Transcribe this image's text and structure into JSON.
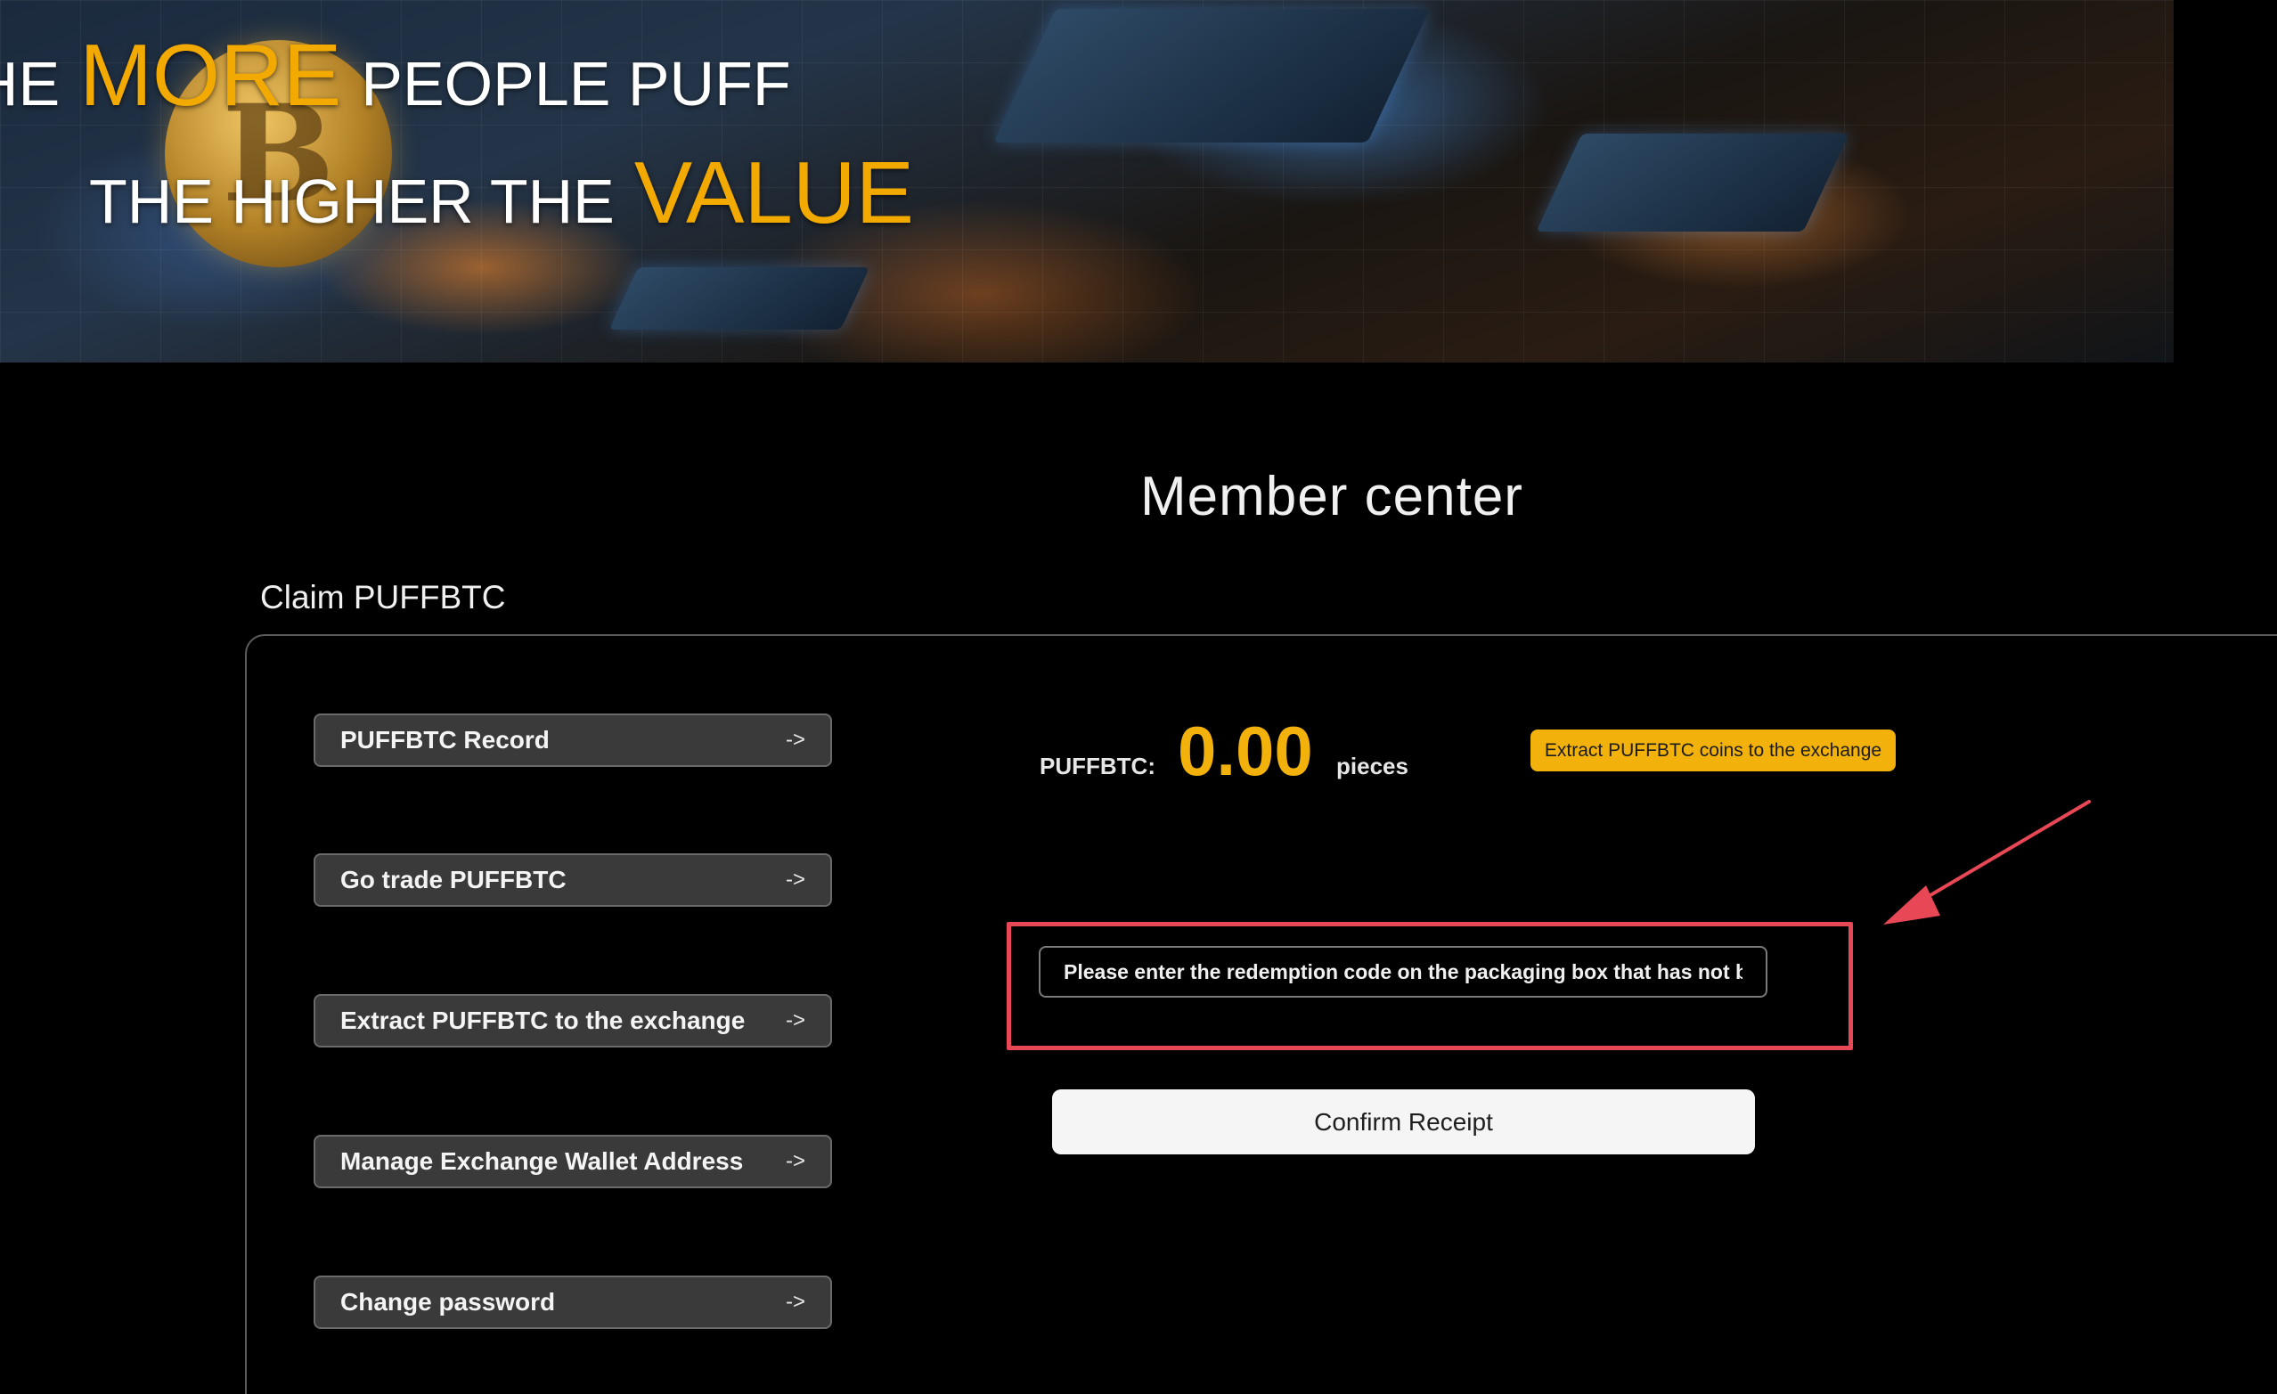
{
  "banner": {
    "line1_prefix": "HE",
    "line1_accent": "MORE",
    "line1_suffix": "PEOPLE PUFF",
    "line2_prefix": "THE HIGHER THE",
    "line2_accent": "VALUE",
    "coin_symbol": "B",
    "accent_color": "#f2a900"
  },
  "page": {
    "title": "Member center",
    "section_heading": "Claim PUFFBTC"
  },
  "menu": {
    "items": [
      {
        "label": "PUFFBTC Record",
        "arrow": "->"
      },
      {
        "label": "Go trade PUFFBTC",
        "arrow": "->"
      },
      {
        "label": "Extract PUFFBTC to the exchange",
        "arrow": "->"
      },
      {
        "label": "Manage Exchange Wallet Address",
        "arrow": "->"
      },
      {
        "label": "Change password",
        "arrow": "->"
      }
    ]
  },
  "balance": {
    "label": "PUFFBTC:",
    "value": "0.00",
    "unit": "pieces",
    "value_color": "#f2b20b"
  },
  "extract_badge": {
    "label": "Extract PUFFBTC coins to the exchange"
  },
  "redeem": {
    "placeholder": "Please enter the redemption code on the packaging box that has not been redeemed",
    "confirm_label": "Confirm Receipt",
    "highlight_color": "#e84855"
  }
}
